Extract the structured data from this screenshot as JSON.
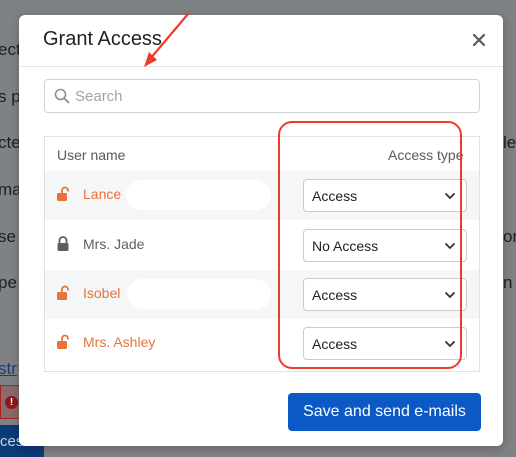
{
  "background": {
    "fragments": [
      "ecti",
      "s pr",
      "cte",
      "ma",
      "se",
      "pe",
      "le",
      "on",
      "n ",
      "str"
    ],
    "button_label": "cess"
  },
  "modal": {
    "title": "Grant Access",
    "search": {
      "placeholder": "Search",
      "value": ""
    },
    "table": {
      "col_user": "User name",
      "col_access": "Access type",
      "rows": [
        {
          "name": "Lance",
          "access": "Access",
          "locked": false
        },
        {
          "name": "Mrs. Jade",
          "access": "No Access",
          "locked": true
        },
        {
          "name": "Isobel",
          "access": "Access",
          "locked": false
        },
        {
          "name": "Mrs. Ashley",
          "access": "Access",
          "locked": false
        }
      ]
    },
    "primary_button": "Save and send e-mails"
  },
  "colors": {
    "accent": "#0b59c5",
    "unlocked_user": "#e8733a",
    "annotation": "#ee3b2c"
  },
  "icons": {
    "close": "close-icon",
    "search": "search-icon",
    "unlocked": "unlock-icon",
    "locked": "lock-icon",
    "chevron": "chevron-down-icon"
  }
}
